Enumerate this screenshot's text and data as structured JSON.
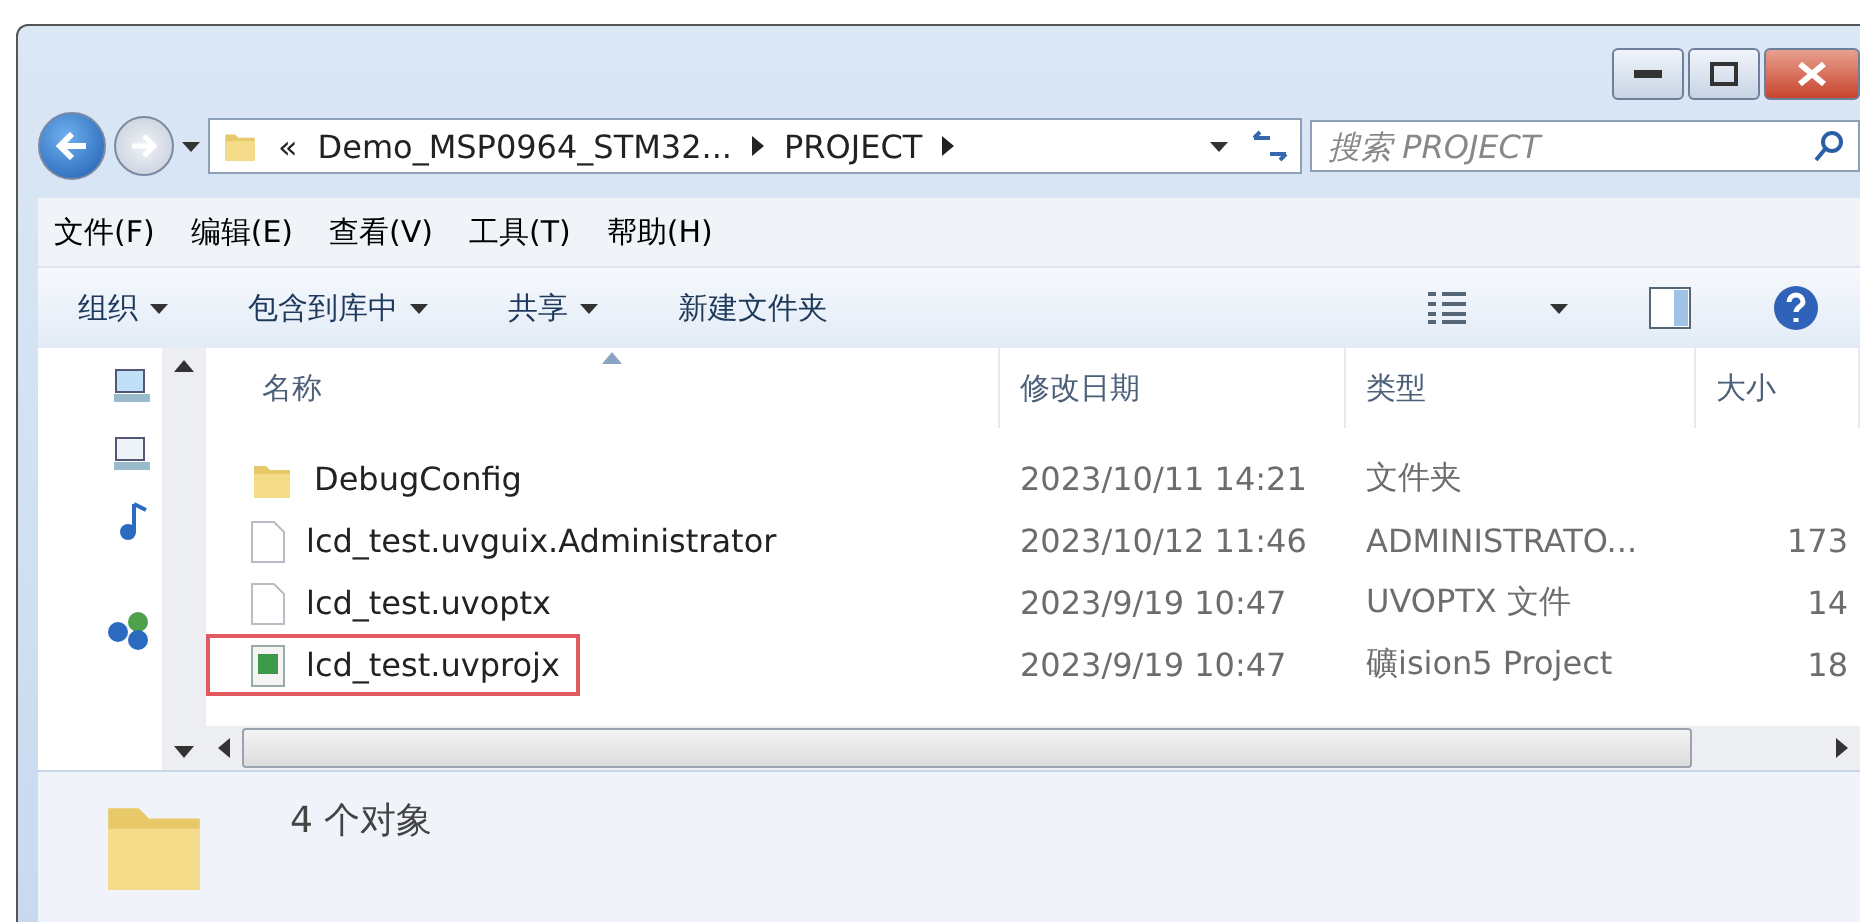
{
  "address": {
    "overflow": "«",
    "crumbs": [
      "Demo_MSP0964_STM32...",
      "PROJECT"
    ]
  },
  "search": {
    "placeholder": "搜索 PROJECT"
  },
  "menu": [
    "文件(F)",
    "编辑(E)",
    "查看(V)",
    "工具(T)",
    "帮助(H)"
  ],
  "toolbar": [
    {
      "label": "组织",
      "dropdown": true
    },
    {
      "label": "包含到库中",
      "dropdown": true
    },
    {
      "label": "共享",
      "dropdown": true
    },
    {
      "label": "新建文件夹",
      "dropdown": false
    }
  ],
  "columns": [
    {
      "label": "名称",
      "sorted": true
    },
    {
      "label": "修改日期",
      "sorted": false
    },
    {
      "label": "类型",
      "sorted": false
    },
    {
      "label": "大小",
      "sorted": false
    }
  ],
  "rows": [
    {
      "kind": "folder",
      "name": "DebugConfig",
      "date": "2023/10/11 14:21",
      "type": "文件夹",
      "highlighted": false
    },
    {
      "kind": "file",
      "name": "lcd_test.uvguix.Administrator",
      "date": "2023/10/12 11:46",
      "type": "ADMINISTRATO...",
      "size": "173",
      "highlighted": false
    },
    {
      "kind": "file",
      "name": "lcd_test.uvoptx",
      "date": "2023/9/19 10:47",
      "type": "UVOPTX 文件",
      "size": "14",
      "highlighted": false
    },
    {
      "kind": "project",
      "name": "lcd_test.uvprojx",
      "date": "2023/9/19 10:47",
      "type": "礦ision5 Project",
      "size": "18",
      "highlighted": true
    }
  ],
  "status_bar": {
    "count": "4 个对象"
  }
}
